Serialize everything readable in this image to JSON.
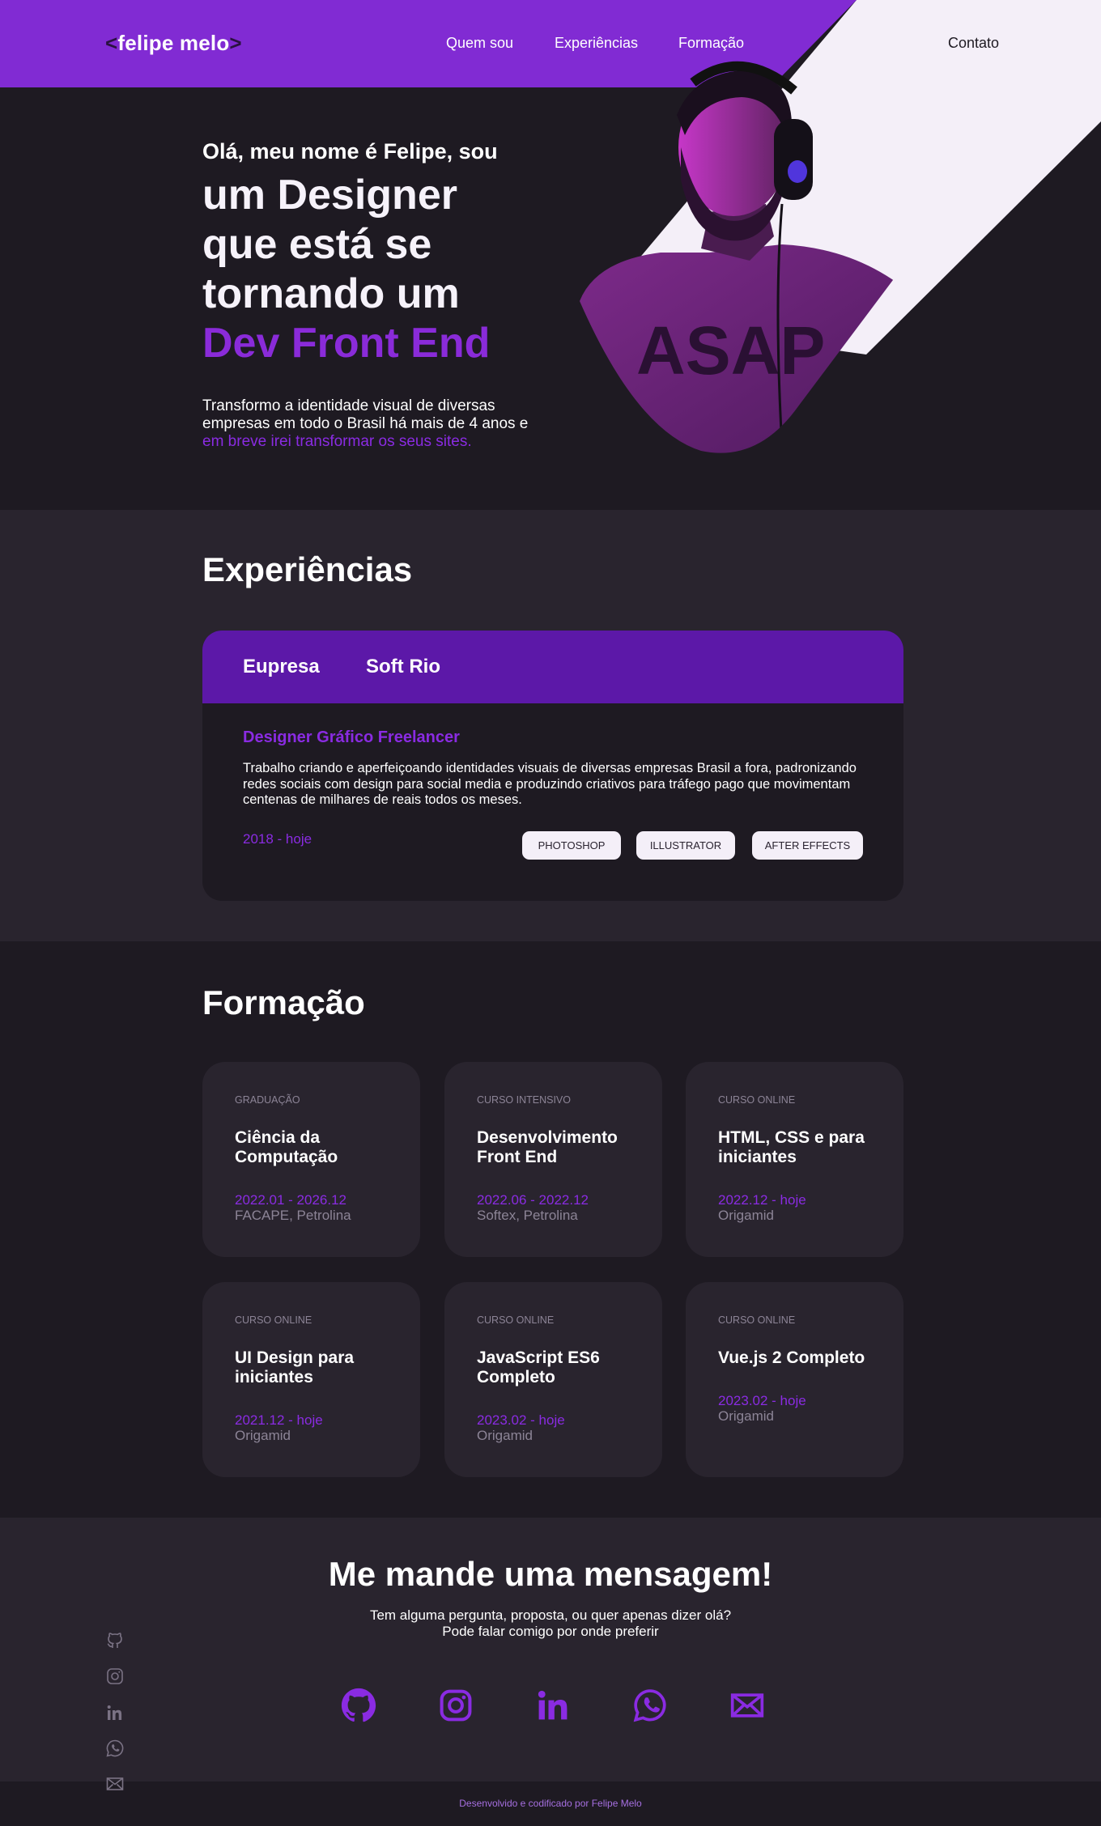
{
  "nav": {
    "logo": "felipe melo",
    "logo_open": "<",
    "logo_close": ">",
    "links": [
      "Quem sou",
      "Experiências",
      "Formação"
    ],
    "contact": "Contato"
  },
  "hero": {
    "greeting": "Olá, meu nome é Felipe, sou",
    "title_line1": "um Designer",
    "title_line2": "que está se",
    "title_line3": "tornando um",
    "title_accent": "Dev Front End",
    "desc": "Transformo a identidade visual de diversas empresas em todo o Brasil há mais de 4 anos e",
    "desc_accent": "em breve irei transformar os seus sites.",
    "portrait_text": "ASAP"
  },
  "experiences": {
    "title": "Experiências",
    "tabs": [
      "Eupresa",
      "Soft Rio"
    ],
    "role": "Designer Gráfico Freelancer",
    "description": "Trabalho criando e aperfeiçoando identidades visuais de diversas empresas Brasil a fora, padronizando redes sociais com design para social media e produzindo criativos para tráfego pago que movimentam centenas de milhares de reais todos os meses.",
    "period": "2018 - hoje",
    "skills": [
      "PHOTOSHOP",
      "ILLUSTRATOR",
      "AFTER EFFECTS"
    ]
  },
  "education": {
    "title": "Formação",
    "items": [
      {
        "type": "GRADUAÇÃO",
        "name": "Ciência da Computação",
        "date": "2022.01 - 2026.12",
        "place": "FACAPE, Petrolina"
      },
      {
        "type": "CURSO INTENSIVO",
        "name": "Desenvolvimento Front End",
        "date": "2022.06 - 2022.12",
        "place": "Softex, Petrolina"
      },
      {
        "type": "CURSO ONLINE",
        "name": "HTML, CSS e para iniciantes",
        "date": "2022.12 - hoje",
        "place": "Origamid"
      },
      {
        "type": "CURSO ONLINE",
        "name": "UI Design para iniciantes",
        "date": "2021.12 - hoje",
        "place": "Origamid"
      },
      {
        "type": "CURSO ONLINE",
        "name": "JavaScript ES6 Completo",
        "date": "2023.02 - hoje",
        "place": "Origamid"
      },
      {
        "type": "CURSO ONLINE",
        "name": "Vue.js 2 Completo",
        "date": "2023.02 - hoje",
        "place": "Origamid"
      }
    ]
  },
  "contact": {
    "title": "Me mande uma mensagem!",
    "subtitle_line1": "Tem alguma pergunta, proposta, ou quer apenas dizer olá?",
    "subtitle_line2": "Pode falar comigo por onde preferir",
    "icons": [
      "github-icon",
      "instagram-icon",
      "linkedin-icon",
      "whatsapp-icon",
      "mail-icon"
    ]
  },
  "footer": {
    "text": "Desenvolvido e codificado por Felipe Melo"
  },
  "colors": {
    "accent": "#8a2be2",
    "header": "#812bd3",
    "tab_bar": "#5c18a8",
    "dark_bg": "#1e1a22",
    "section_bg": "#29242e",
    "light": "#f4eff8"
  }
}
